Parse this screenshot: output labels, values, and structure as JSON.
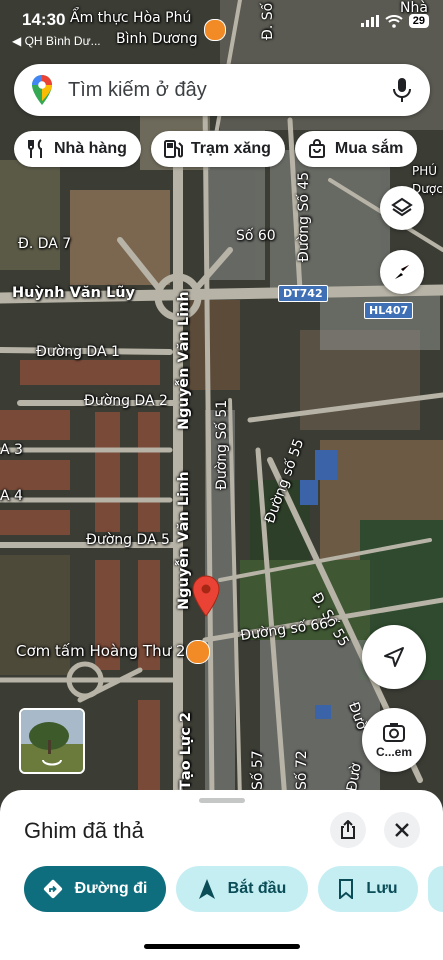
{
  "status_bar": {
    "time": "14:30",
    "back_label": "◀ QH Bình Dư...",
    "battery": "29"
  },
  "search": {
    "placeholder": "Tìm kiếm ở đây"
  },
  "chips": [
    {
      "label": "Nhà hàng",
      "icon": "fork-knife-icon"
    },
    {
      "label": "Trạm xăng",
      "icon": "gas-station-icon"
    },
    {
      "label": "Mua sắm",
      "icon": "shopping-bag-icon"
    }
  ],
  "map_labels": {
    "poi_top": "Ẩm thực Hòa Phú",
    "city": "Bình Dương",
    "road_top_so": "Đ. Số 6",
    "nha": "Nhà",
    "phu": "PHÚ",
    "duoc": "Dược",
    "duong_so_45": "Đường Số 45",
    "so_60": "Số 60",
    "da_7": "Đ. DA 7",
    "huynh_van_luy": "Huỳnh Văn Lũy",
    "dt742": "DT742",
    "hl407": "HL407",
    "da_1": "Đường DA 1",
    "da_2": "Đường DA 2",
    "nguyen_van_linh_1": "Nguyễn Văn Linh",
    "nguyen_van_linh_2": "Nguyễn Văn Linh",
    "duong_so_51": "Đường Số 51",
    "duong_so_55a": "Đường số 55",
    "duong_so_55b": "Đ. Số 55",
    "a3": "A 3",
    "a4": "A 4",
    "da_5": "Đường DA 5",
    "duong_so_66": "Đường số 66",
    "com_tam": "Cơm tấm Hoàng Thư 2",
    "tao_luc_2": "Tạo Lực 2",
    "so_57": "Số 57",
    "so_72": "Số 72",
    "d_top_right": "Đườ",
    "d_right": "Đườ"
  },
  "fab": {
    "streetview_label": "C...em"
  },
  "sheet": {
    "title": "Ghim đã thả",
    "actions": [
      {
        "label": "Đường đi",
        "icon": "directions-icon"
      },
      {
        "label": "Bắt đầu",
        "icon": "navigation-arrow-icon"
      },
      {
        "label": "Lưu",
        "icon": "bookmark-icon"
      }
    ]
  },
  "colors": {
    "accent": "#0b57d0",
    "primary_button": "#0f6e7d",
    "secondary_button": "#c5eef3",
    "pin_red": "#ea4335"
  }
}
